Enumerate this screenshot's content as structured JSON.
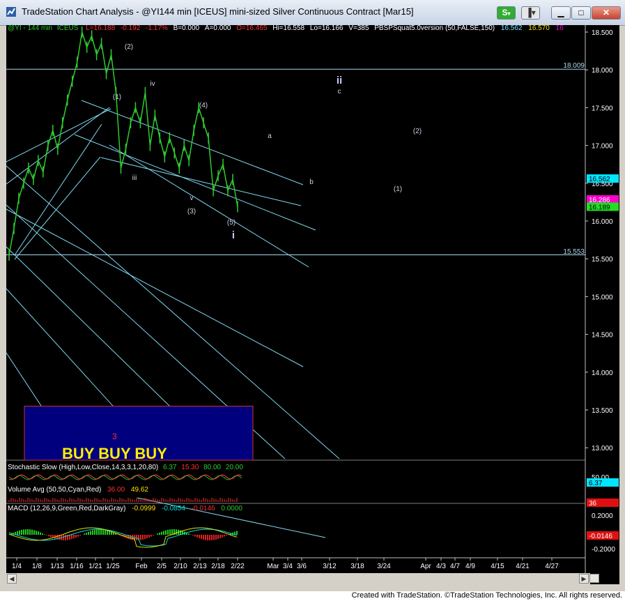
{
  "window": {
    "title": "TradeStation Chart Analysis - @YI144 min [ICEUS] mini-sized Silver Continuous Contract [Mar15]",
    "buttons": {
      "strategy": "S",
      "strategy_arrow": "▾",
      "tools_arrow": "▾",
      "minimize": "▁",
      "maximize": "□",
      "close": "✕"
    }
  },
  "legend": {
    "symbol": "@YI - 144 min",
    "exchange": "ICEUS",
    "last": "L=16.188",
    "change": "-0.192",
    "change_pct": "-1.17%",
    "bid": "B=0.000",
    "ask": "A=0.000",
    "open": "O=16.465",
    "high": "Hi=16.558",
    "low": "Lo=16.166",
    "volume": "V=385",
    "indicator": "PBSPSquat5.0version (50,FALSE,150)",
    "ind_v1": "16.562",
    "ind_v2": "16.570",
    "ind_v3": "16"
  },
  "colors": {
    "price_bars": "#2ecc2e",
    "channel_lines": "#7fd9f0",
    "hlines": "#a9d9f0",
    "box_fill": "#00007f",
    "box_border": "#d43030",
    "buy_text": "#ffee00",
    "stoch_k": "#ff4040",
    "stoch_d": "#22bb22",
    "macd_line": "#e8e400",
    "macd_signal": "#00e0e0",
    "tag_cyan": "#00e5ff",
    "tag_magenta": "#ff00cc",
    "tag_green": "#22dd22",
    "tag_red": "#e01010"
  },
  "chart_data": {
    "type": "line",
    "title": "TradeStation Chart Analysis - @YI144 min [ICEUS] mini-sized Silver Continuous Contract [Mar15]",
    "price_axis": {
      "ticks": [
        "18.500",
        "18.000",
        "17.500",
        "17.000",
        "16.500",
        "16.000",
        "15.500",
        "15.000",
        "14.500",
        "14.000",
        "13.500",
        "13.000"
      ],
      "ylim": [
        12.9,
        18.7
      ],
      "tags": [
        {
          "label": "18.009",
          "value": 18.009
        },
        {
          "label": "15.553",
          "value": 15.553
        },
        {
          "label": "16.562",
          "value": 16.562
        },
        {
          "label": "16.286",
          "value": 16.286
        },
        {
          "label": "16.189",
          "value": 16.189
        }
      ]
    },
    "x_axis": {
      "ticks": [
        "1/4",
        "1/8",
        "1/13",
        "1/16",
        "1/21",
        "1/25",
        "Feb",
        "2/5",
        "2/10",
        "2/13",
        "2/18",
        "2/22",
        "Mar",
        "3/4",
        "3/6",
        "3/12",
        "3/18",
        "3/24",
        "Apr",
        "4/3",
        "4/7",
        "4/9",
        "4/15",
        "4/21",
        "4/27"
      ]
    },
    "price_series": {
      "name": "@YI - 144 min",
      "values": [
        15.55,
        15.9,
        16.3,
        16.5,
        16.7,
        16.55,
        16.8,
        16.65,
        17.0,
        17.2,
        16.95,
        17.3,
        17.6,
        17.85,
        18.1,
        18.5,
        18.3,
        18.45,
        18.2,
        18.35,
        17.95,
        18.2,
        17.7,
        16.7,
        16.95,
        17.3,
        17.5,
        17.3,
        17.7,
        17.0,
        17.4,
        17.1,
        16.85,
        17.1,
        16.9,
        16.7,
        17.0,
        16.8,
        17.2,
        17.5,
        17.3,
        17.1,
        16.4,
        16.6,
        16.75,
        16.4,
        16.55,
        16.19
      ]
    },
    "horizontal_lines": [
      18.009,
      15.553
    ],
    "wave_labels": [
      "(1)",
      "(2)",
      "iii",
      "iv",
      "v",
      "(3)",
      "(4)",
      "(5)",
      "i",
      "ii",
      "a",
      "b",
      "c",
      "(1)",
      "(2)"
    ],
    "box_annotation": {
      "text": "BUY BUY BUY",
      "number": "3",
      "price_top": 13.55
    },
    "stochastic": {
      "title": "Stochastic Slow (High,Low,Close,14,3,3,1,20,80)",
      "values": [
        "6.37",
        "15.30",
        "80.00",
        "20.00"
      ],
      "axis": [
        "50.00"
      ],
      "tags": [
        "6.37",
        "36"
      ]
    },
    "volume": {
      "title": "Volume Avg (50,50,Cyan,Red)",
      "values": [
        "36.00",
        "49.62"
      ]
    },
    "macd": {
      "title": "MACD (12,26,9,Green,Red,DarkGray)",
      "values": [
        "-0.0999",
        "-0.0854",
        "-0.0146",
        "0.0000"
      ],
      "axis": [
        "0.2000",
        "-0.2000"
      ],
      "tag": "-0.0146"
    }
  },
  "footer": "Created with TradeStation. ©TradeStation Technologies, Inc. All rights reserved."
}
